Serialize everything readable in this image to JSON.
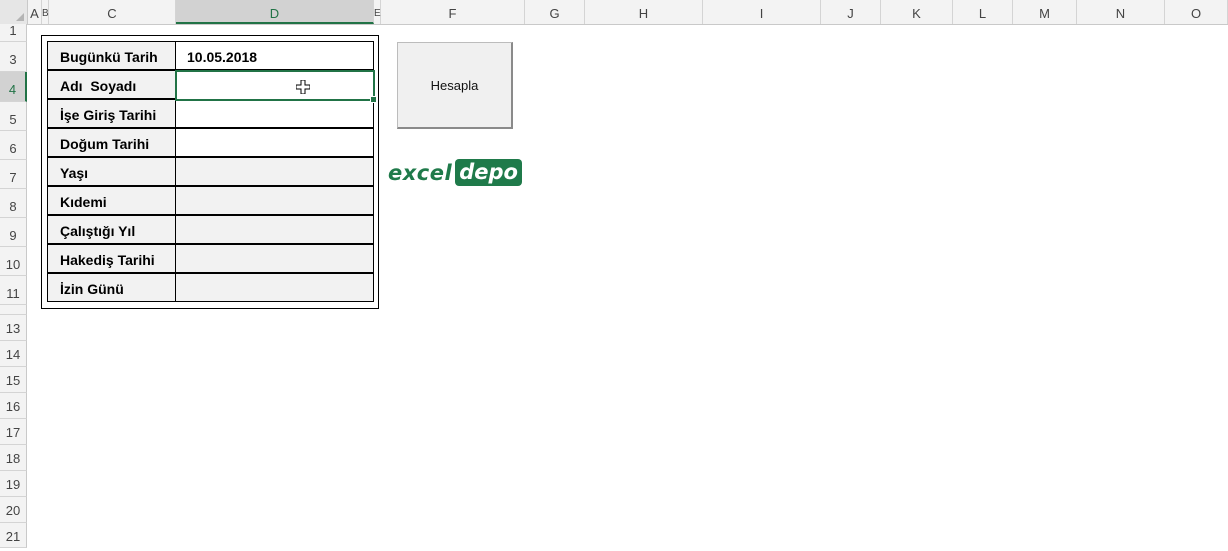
{
  "columns": [
    "A",
    "B",
    "C",
    "D",
    "E",
    "F",
    "G",
    "H",
    "I",
    "J",
    "K",
    "L",
    "M",
    "N",
    "O"
  ],
  "selected_column": "D",
  "rows": [
    "1",
    "3",
    "4",
    "5",
    "6",
    "7",
    "8",
    "9",
    "10",
    "11",
    "13",
    "14",
    "15",
    "16",
    "17",
    "18",
    "19",
    "20",
    "21"
  ],
  "selected_row": "4",
  "form": {
    "rows": [
      {
        "label": "Bugünkü Tarih",
        "value": "10.05.2018"
      },
      {
        "label": "Adı  Soyadı",
        "value": ""
      },
      {
        "label": "İşe Giriş Tarihi",
        "value": ""
      },
      {
        "label": "Doğum Tarihi",
        "value": ""
      },
      {
        "label": "Yaşı",
        "value": ""
      },
      {
        "label": "Kıdemi",
        "value": ""
      },
      {
        "label": "Çalıştığı Yıl",
        "value": ""
      },
      {
        "label": "Hakediş Tarihi",
        "value": ""
      },
      {
        "label": "İzin Günü",
        "value": ""
      }
    ]
  },
  "button": {
    "label": "Hesapla"
  },
  "logo": {
    "part1": "excel",
    "part2": "depo"
  },
  "colors": {
    "accent": "#217346",
    "logo_green": "#1f7a4a",
    "cell_fill": "#f2f2f2"
  },
  "icons": {
    "cursor": "cell-select-cross-icon"
  }
}
